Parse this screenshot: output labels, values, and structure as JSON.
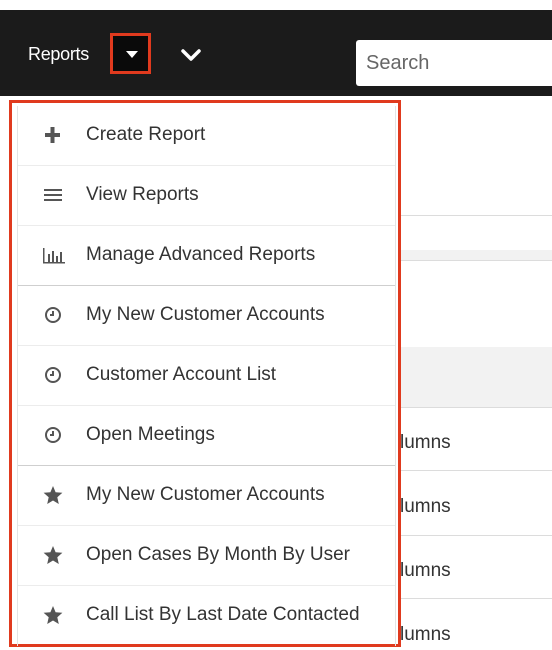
{
  "topbar": {
    "module_label": "Reports",
    "search_placeholder": "Search"
  },
  "menu": {
    "items": [
      {
        "icon": "plus-icon",
        "label": "Create Report"
      },
      {
        "icon": "list-icon",
        "label": "View Reports"
      },
      {
        "icon": "bar-chart-icon",
        "label": "Manage Advanced Reports"
      },
      {
        "icon": "clock-icon",
        "label": "My New Customer Accounts"
      },
      {
        "icon": "clock-icon",
        "label": "Customer Account List"
      },
      {
        "icon": "clock-icon",
        "label": "Open Meetings"
      },
      {
        "icon": "star-icon",
        "label": "My New Customer Accounts"
      },
      {
        "icon": "star-icon",
        "label": "Open Cases By Month By User"
      },
      {
        "icon": "star-icon",
        "label": "Call List By Last Date Contacted"
      }
    ]
  },
  "background": {
    "row_fragments": [
      "lumns",
      "lumns",
      "lumns",
      "lumns"
    ]
  },
  "colors": {
    "topbar": "#1b1b1b",
    "highlight": "#e03a1e",
    "icon": "#555555"
  }
}
